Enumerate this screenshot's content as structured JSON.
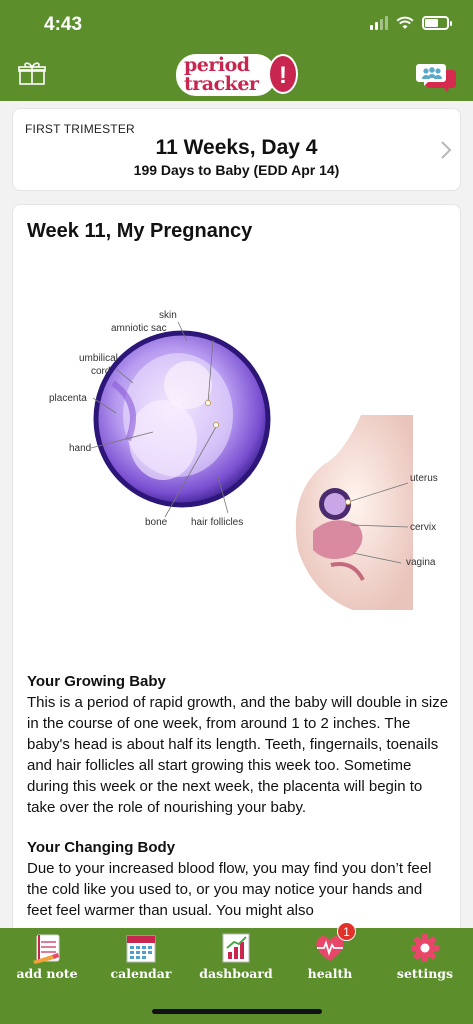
{
  "status_bar": {
    "time": "4:43"
  },
  "header": {
    "logo_line1": "period",
    "logo_line2": "tracker",
    "logo_mark": "!",
    "left_icon": "gift-icon",
    "right_icon": "community-chat-icon"
  },
  "trimester_card": {
    "label": "FIRST TRIMESTER",
    "title": "11 Weeks, Day 4",
    "subtitle": "199 Days to Baby (EDD Apr 14)"
  },
  "week_card": {
    "title": "Week 11, My Pregnancy",
    "illustration_labels": {
      "skin": "skin",
      "amniotic_sac": "amniotic sac",
      "umbilical_cord_1": "umbilical",
      "umbilical_cord_2": "cord",
      "placenta": "placenta",
      "hand": "hand",
      "bone": "bone",
      "hair_follicles": "hair follicles",
      "uterus": "uterus",
      "cervix": "cervix",
      "vagina": "vagina"
    },
    "sections": [
      {
        "heading": "Your Growing Baby",
        "body": "This is a period of rapid growth, and the baby will double in size in the course of one week, from around 1 to 2 inches. The baby's head is about half its length. Teeth, fingernails, toenails and hair follicles all start growing this week too. Sometime during this week or the next week, the placenta will begin to take over the role of nourishing your baby."
      },
      {
        "heading": "Your Changing Body",
        "body": "Due to your increased blood flow, you may find you don’t feel the cold like you used to, or you may notice your hands and feet feel warmer than usual. You might also"
      }
    ]
  },
  "tabbar": {
    "items": [
      {
        "label": "add note",
        "icon": "notebook-icon"
      },
      {
        "label": "calendar",
        "icon": "calendar-icon"
      },
      {
        "label": "dashboard",
        "icon": "chart-icon"
      },
      {
        "label": "health",
        "icon": "heartbeat-icon",
        "badge": "1"
      },
      {
        "label": "settings",
        "icon": "gear-icon"
      }
    ]
  },
  "colors": {
    "brand_green": "#5c8f2c",
    "logo_red": "#c8264f",
    "badge_red": "#e0312b"
  }
}
